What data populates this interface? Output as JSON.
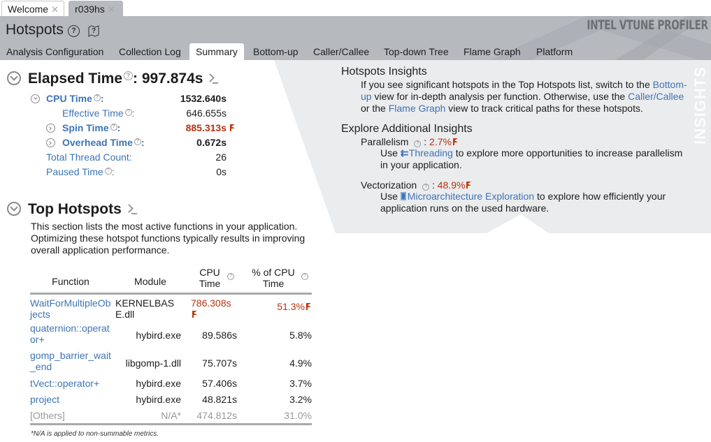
{
  "doc_tabs": [
    {
      "label": "Welcome",
      "active": false
    },
    {
      "label": "r039hs",
      "active": true
    }
  ],
  "header": {
    "title": "Hotspots",
    "help_icon": "question-circle-icon",
    "map_icon": "analysis-map-icon",
    "brand": "INTEL VTUNE PROFILER",
    "colors": {
      "header_bg": "#b6babf",
      "panel_bg": "#ebecee",
      "link": "#3d74b5",
      "alert": "#b5330f"
    }
  },
  "nav_tabs": [
    {
      "label": "Analysis Configuration",
      "active": false
    },
    {
      "label": "Collection Log",
      "active": false
    },
    {
      "label": "Summary",
      "active": true
    },
    {
      "label": "Bottom-up",
      "active": false
    },
    {
      "label": "Caller/Callee",
      "active": false
    },
    {
      "label": "Top-down Tree",
      "active": false
    },
    {
      "label": "Flame Graph",
      "active": false
    },
    {
      "label": "Platform",
      "active": false
    }
  ],
  "elapsed": {
    "label": "Elapsed Time",
    "value": "997.874s",
    "metrics": {
      "cpu_time": {
        "label": "CPU Time",
        "value": "1532.640s"
      },
      "effective_time": {
        "label": "Effective Time",
        "value": "646.655s"
      },
      "spin_time": {
        "label": "Spin Time",
        "value": "885.313s",
        "flagged": true
      },
      "overhead_time": {
        "label": "Overhead Time",
        "value": "0.672s"
      },
      "total_thread_count": {
        "label": "Total Thread Count:",
        "value": "26"
      },
      "paused_time": {
        "label": "Paused Time",
        "value": "0s"
      }
    }
  },
  "top_hotspots": {
    "title": "Top Hotspots",
    "description": "This section lists the most active functions in your application. Optimizing these hotspot functions typically results in improving overall application performance.",
    "columns": {
      "function": "Function",
      "module": "Module",
      "cpu_time": "CPU Time",
      "pct_cpu": "% of CPU Time"
    },
    "rows": [
      {
        "function": "WaitForMultipleObjects",
        "module": "KERNELBASE.dll",
        "cpu_time": "786.308s",
        "pct": "51.3%",
        "flagged": true
      },
      {
        "function": "quaternion::operator+",
        "module": "hybird.exe",
        "cpu_time": "89.586s",
        "pct": "5.8%",
        "flagged": false
      },
      {
        "function": "gomp_barrier_wait_end",
        "module": "libgomp-1.dll",
        "cpu_time": "75.707s",
        "pct": "4.9%",
        "flagged": false
      },
      {
        "function": "tVect::operator+",
        "module": "hybird.exe",
        "cpu_time": "57.406s",
        "pct": "3.7%",
        "flagged": false
      },
      {
        "function": "project",
        "module": "hybird.exe",
        "cpu_time": "48.821s",
        "pct": "3.2%",
        "flagged": false
      },
      {
        "function": "[Others]",
        "module": "N/A*",
        "cpu_time": "474.812s",
        "pct": "31.0%",
        "flagged": false
      }
    ],
    "footnote": "*N/A is applied to non-summable metrics."
  },
  "insights": {
    "vertical_label": "INSIGHTS",
    "hotspots": {
      "title": "Hotspots Insights",
      "text_1": "If you see significant hotspots in the Top Hotspots list, switch to the ",
      "link_1": "Bottom-up",
      "text_2": " view for in-depth analysis per function. Otherwise, use the ",
      "link_2": "Caller/Callee",
      "text_3": " or the ",
      "link_3": "Flame Graph",
      "text_4": " view to track critical paths for these hotspots."
    },
    "explore": {
      "title": "Explore Additional Insights",
      "parallelism": {
        "label": "Parallelism",
        "value": "2.7%",
        "text_1": "Use ",
        "link": "Threading",
        "text_2": " to explore more opportunities to increase parallelism in your application."
      },
      "vectorization": {
        "label": "Vectorization",
        "value": "48.9%",
        "text_1": "Use ",
        "link": "Microarchitecture Exploration",
        "text_2": " to explore how efficiently your application runs on the used hardware."
      }
    }
  }
}
